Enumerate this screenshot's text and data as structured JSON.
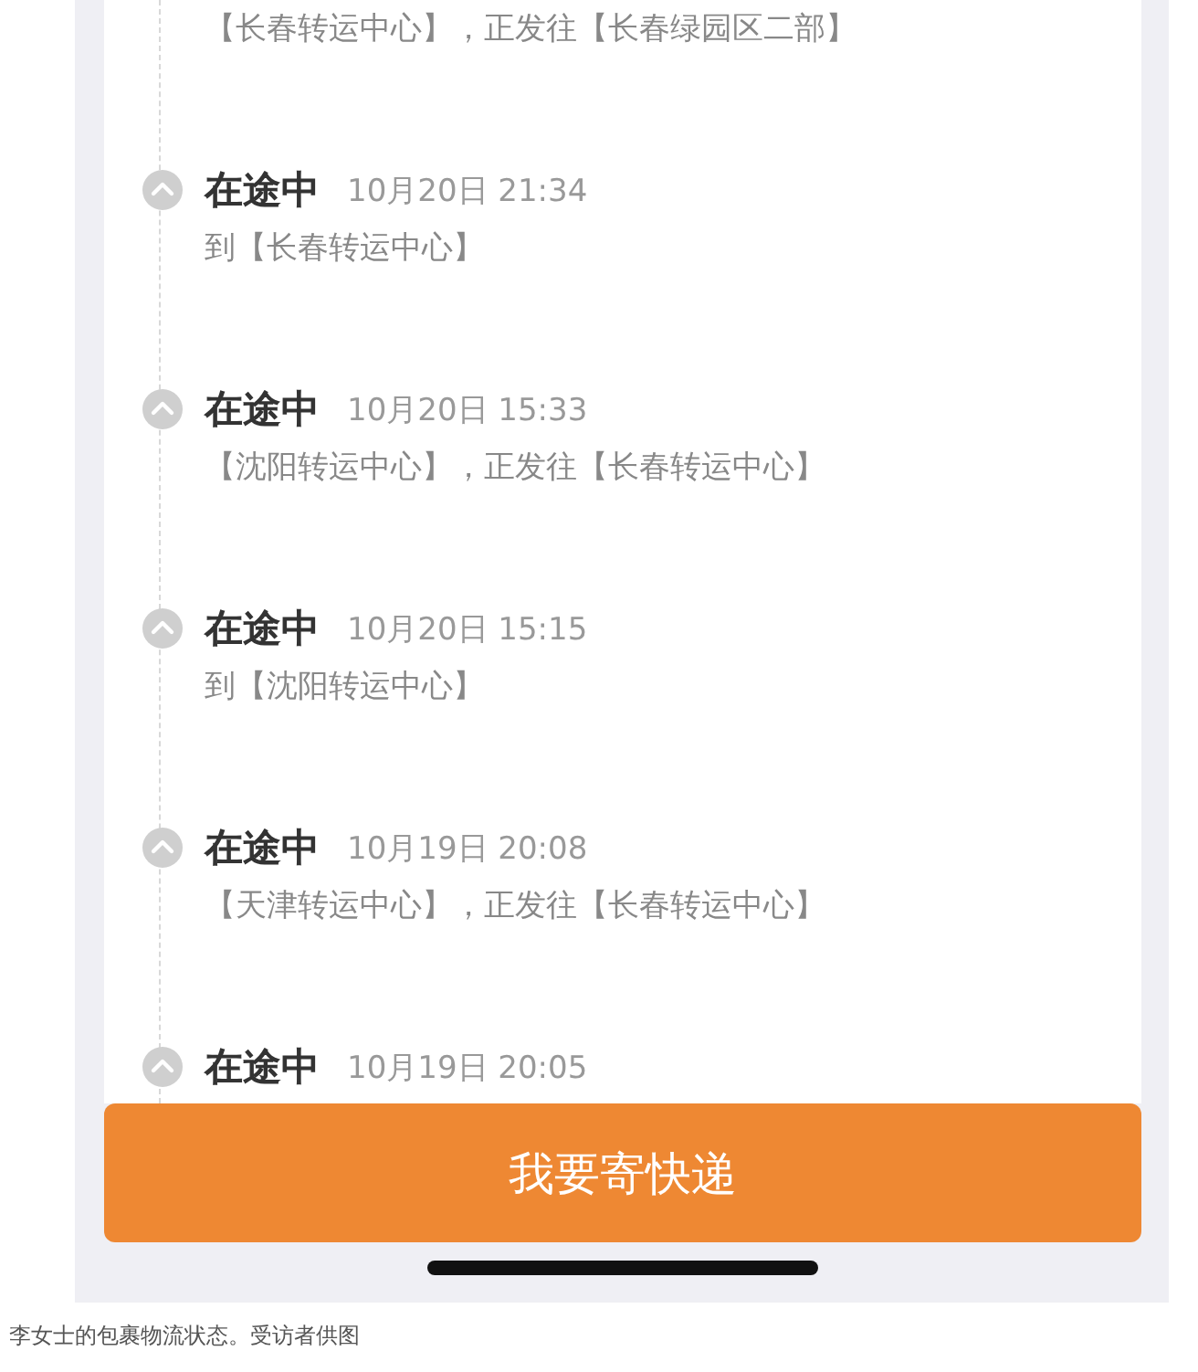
{
  "tracking": [
    {
      "description": "【长春转运中心】，正发往【长春绿园区二部】"
    },
    {
      "status": "在途中",
      "time": "10月20日 21:34",
      "description": "到【长春转运中心】"
    },
    {
      "status": "在途中",
      "time": "10月20日 15:33",
      "description": "【沈阳转运中心】，正发往【长春转运中心】"
    },
    {
      "status": "在途中",
      "time": "10月20日 15:15",
      "description": "到【沈阳转运中心】"
    },
    {
      "status": "在途中",
      "time": "10月19日 20:08",
      "description": "【天津转运中心】，正发往【长春转运中心】"
    },
    {
      "status": "在途中",
      "time": "10月19日 20:05"
    }
  ],
  "send_button": "我要寄快递",
  "caption": "李女士的包裹物流状态。受访者供图"
}
